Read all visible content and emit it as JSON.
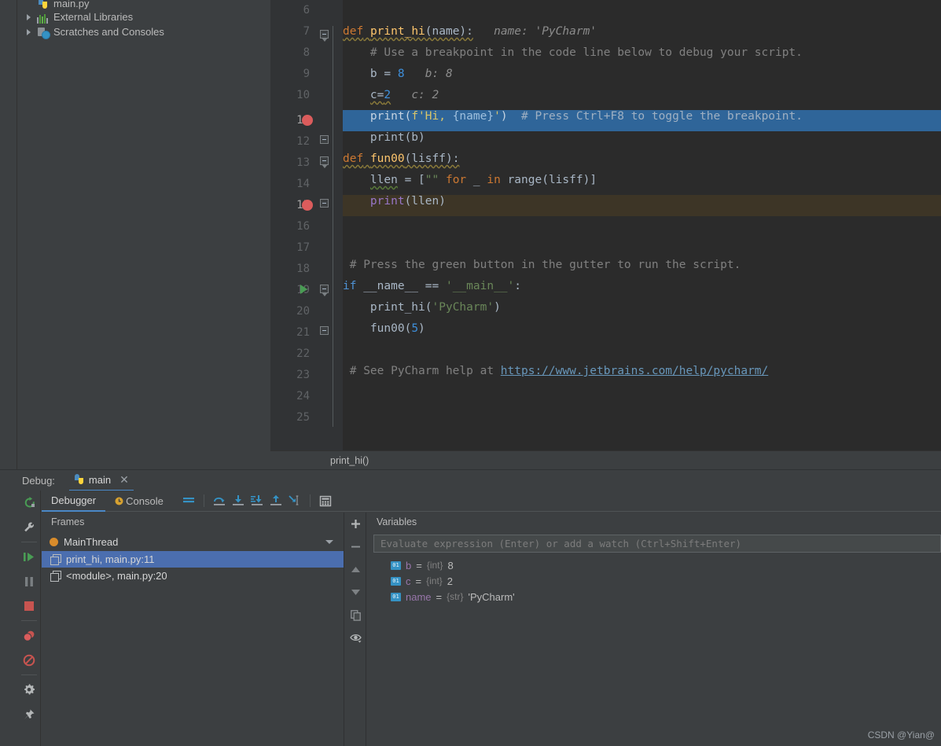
{
  "project_tree": {
    "items": [
      {
        "label": "main.py",
        "icon": "python-file-icon",
        "partial": true,
        "expandable": false
      },
      {
        "label": "External Libraries",
        "icon": "libraries-icon",
        "partial": false,
        "expandable": true
      },
      {
        "label": "Scratches and Consoles",
        "icon": "scratches-icon",
        "partial": false,
        "expandable": true
      }
    ]
  },
  "editor": {
    "breadcrumb": "print_hi()",
    "lines": [
      {
        "num": "6",
        "text": ""
      },
      {
        "num": "7",
        "text": "def print_hi(name):   name: 'PyCharm'"
      },
      {
        "num": "8",
        "text": "    # Use a breakpoint in the code line below to debug your script."
      },
      {
        "num": "9",
        "text": "    b = 8   b: 8"
      },
      {
        "num": "10",
        "text": "    c=2   c: 2"
      },
      {
        "num": "11",
        "text": "    print(f'Hi, {name}')  # Press Ctrl+F8 to toggle the breakpoint."
      },
      {
        "num": "12",
        "text": "    print(b)"
      },
      {
        "num": "13",
        "text": "def fun00(lisff):"
      },
      {
        "num": "14",
        "text": "    llen = [\"\" for _ in range(lisff)]"
      },
      {
        "num": "15",
        "text": "    print(llen)"
      },
      {
        "num": "16",
        "text": ""
      },
      {
        "num": "17",
        "text": ""
      },
      {
        "num": "18",
        "text": "# Press the green button in the gutter to run the script."
      },
      {
        "num": "19",
        "text": "if __name__ == '__main__':"
      },
      {
        "num": "20",
        "text": "    print_hi('PyCharm')"
      },
      {
        "num": "21",
        "text": "    fun00(5)"
      },
      {
        "num": "22",
        "text": ""
      },
      {
        "num": "23",
        "text": "# See PyCharm help at https://www.jetbrains.com/help/pycharm/"
      },
      {
        "num": "24",
        "text": ""
      },
      {
        "num": "25",
        "text": ""
      }
    ],
    "tokens": {
      "kw_def": "def",
      "fn_print_hi": "print_hi",
      "fn_fun00": "fun00",
      "hint_name": "name: 'PyCharm'",
      "hint_b": "b: 8",
      "hint_c": "c: 2",
      "comment_line8": "# Use a breakpoint in the code line below to debug your script.",
      "comment_line11": "# Press Ctrl+F8 to toggle the breakpoint.",
      "comment_line18": "# Press the green button in the gutter to run the script.",
      "comment_line23_prefix": "# See PyCharm help at ",
      "link_line23": "https://www.jetbrains.com/help/pycharm/",
      "kw_if": "if",
      "kw_for": "for",
      "kw_in": "in",
      "dunder_name": "__name__",
      "str_main": "'__main__'",
      "str_pycharm": "'PyCharm'",
      "num_8": "8",
      "num_2": "2",
      "num_5": "5"
    },
    "colors": {
      "background": "#2b2b2b",
      "gutter": "#313335",
      "current_line_highlight": "#2f6599",
      "execution_point_highlight": "#3d3526",
      "breakpoint": "#db5c5c",
      "run_arrow": "#499c54",
      "keyword": "#cc7832",
      "function": "#ffc66d",
      "number": "#3e8fdb",
      "string": "#6a8759",
      "comment": "#808080",
      "link": "#6897bb",
      "default_text": "#a9b7c6"
    }
  },
  "debug_panel": {
    "title": "Debug:",
    "session_tab": {
      "label": "main",
      "icon": "python-icon",
      "close_icon": "close-icon"
    },
    "sidebar_buttons": [
      {
        "name": "rerun-icon",
        "title": "Rerun"
      },
      {
        "name": "settings-wrench-icon",
        "title": "Debugger Settings"
      },
      {
        "name": "resume-program-icon",
        "title": "Resume Program"
      },
      {
        "name": "pause-program-icon",
        "title": "Pause Program"
      },
      {
        "name": "stop-icon",
        "title": "Stop"
      },
      {
        "name": "view-breakpoints-icon",
        "title": "View Breakpoints"
      },
      {
        "name": "mute-breakpoints-icon",
        "title": "Mute Breakpoints"
      },
      {
        "name": "settings-gear-icon",
        "title": "Settings"
      },
      {
        "name": "pin-icon",
        "title": "Pin Tab"
      }
    ],
    "tabs": [
      {
        "label": "Debugger",
        "active": true,
        "icon": null
      },
      {
        "label": "Console",
        "active": false,
        "icon": "console-icon"
      }
    ],
    "toolbar_buttons": [
      {
        "name": "show-execution-point-icon",
        "title": "Show Execution Point"
      },
      {
        "name": "step-over-icon",
        "title": "Step Over"
      },
      {
        "name": "step-into-icon",
        "title": "Step Into"
      },
      {
        "name": "force-step-into-icon",
        "title": "Force Step Into"
      },
      {
        "name": "step-out-icon",
        "title": "Step Out"
      },
      {
        "name": "run-to-cursor-icon",
        "title": "Run to Cursor"
      },
      {
        "name": "evaluate-expression-icon",
        "title": "Evaluate Expression"
      }
    ],
    "frames": {
      "title": "Frames",
      "thread": {
        "label": "MainThread",
        "dot_color": "#d98c2b"
      },
      "items": [
        {
          "label": "print_hi, main.py:11",
          "selected": true
        },
        {
          "label": "<module>, main.py:20",
          "selected": false
        }
      ]
    },
    "variables": {
      "title": "Variables",
      "evaluate_placeholder": "Evaluate expression (Enter) or add a watch (Ctrl+Shift+Enter)",
      "side_buttons": [
        {
          "name": "add-watch-icon",
          "glyph": "+"
        },
        {
          "name": "remove-watch-icon",
          "glyph": "−"
        },
        {
          "name": "move-up-icon",
          "glyph": "▲"
        },
        {
          "name": "move-down-icon",
          "glyph": "▼"
        },
        {
          "name": "copy-icon",
          "glyph": "copy"
        },
        {
          "name": "inspect-eye-icon",
          "glyph": "eye"
        }
      ],
      "rows": [
        {
          "icon": "variable-icon",
          "name": "b",
          "type": "{int}",
          "value": "8"
        },
        {
          "icon": "variable-icon",
          "name": "c",
          "type": "{int}",
          "value": "2"
        },
        {
          "icon": "variable-icon",
          "name": "name",
          "type": "{str}",
          "value": "'PyCharm'"
        }
      ]
    }
  },
  "watermark": "CSDN @Yian@"
}
